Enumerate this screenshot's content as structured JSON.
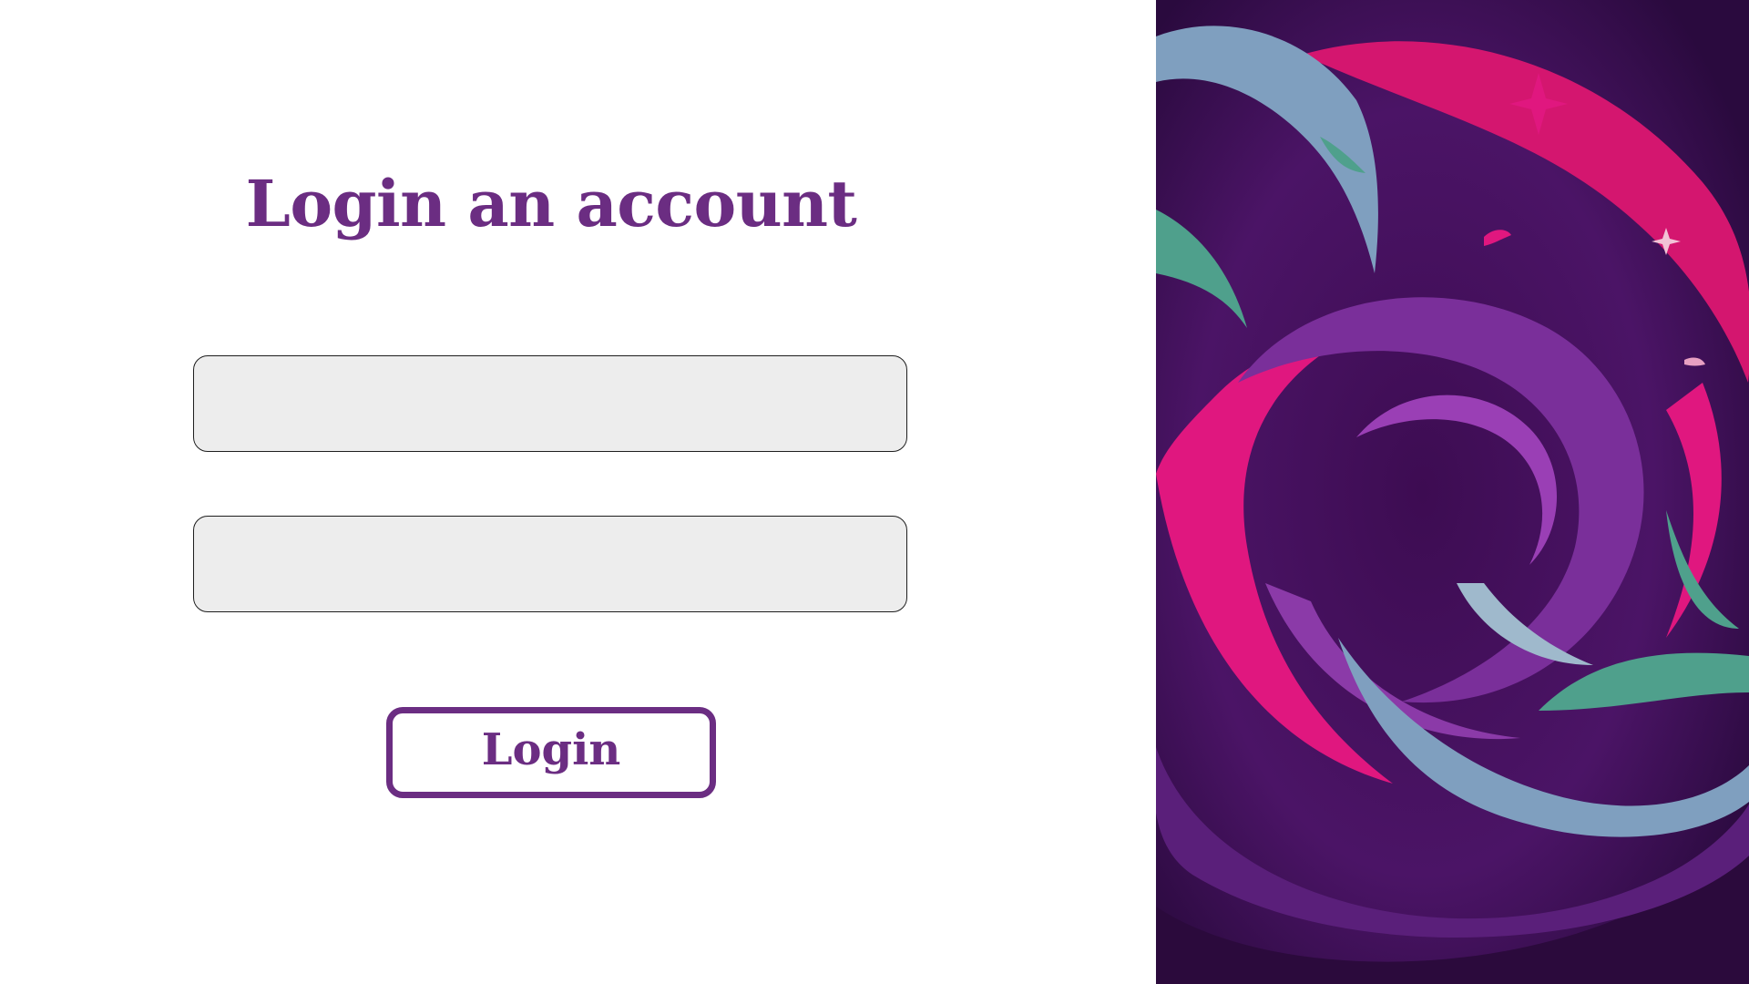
{
  "login": {
    "title": "Login an account",
    "username_field": {
      "value": "",
      "placeholder": ""
    },
    "password_field": {
      "value": "",
      "placeholder": ""
    },
    "submit_label": "Login"
  },
  "colors": {
    "accent": "#6b2d82",
    "field_background": "#ededed",
    "art_deep_purple": "#3a0c4a",
    "art_magenta": "#e0177f",
    "art_violet": "#7a2f9a",
    "art_teal": "#4fa08c",
    "art_blue_grey": "#7f9fbf"
  },
  "decorative_image": {
    "icon": "abstract-swirl-artwork"
  }
}
